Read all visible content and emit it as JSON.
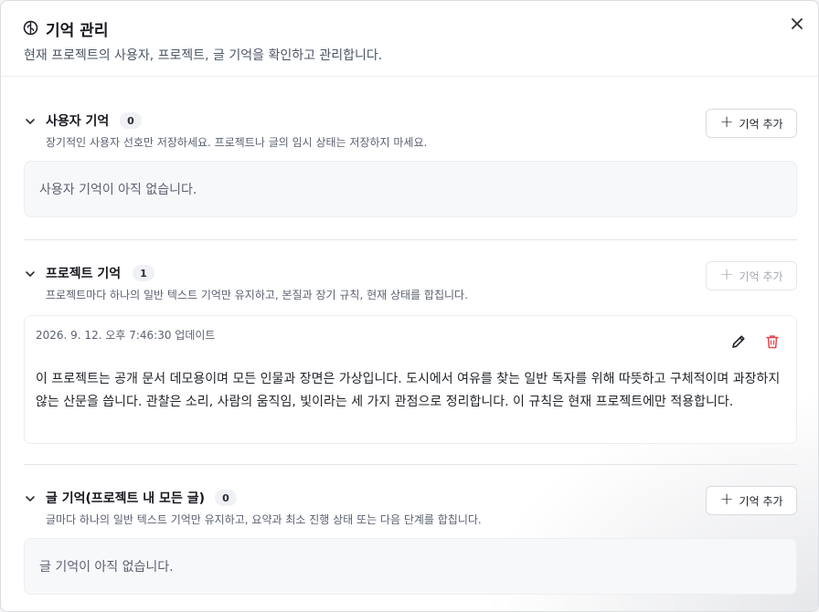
{
  "dialog": {
    "title": "기억 관리",
    "subtitle": "현재 프로젝트의 사용자, 프로젝트, 글 기억을 확인하고 관리합니다.",
    "close_symbol": "×"
  },
  "sections": {
    "user": {
      "title": "사용자 기억",
      "count": "0",
      "description": "장기적인 사용자 선호만 저장하세요. 프로젝트나 글의 임시 상태는 저장하지 마세요.",
      "add_label": "기억 추가",
      "empty_text": "사용자 기억이 아직 없습니다."
    },
    "project": {
      "title": "프로젝트 기억",
      "count": "1",
      "description": "프로젝트마다 하나의 일반 텍스트 기억만 유지하고, 본질과 장기 규칙, 현재 상태를 합칩니다.",
      "add_label": "기억 추가",
      "add_disabled": true,
      "memory": {
        "updated": "2026. 9. 12. 오후 7:46:30 업데이트",
        "text": "이 프로젝트는 공개 문서 데모용이며 모든 인물과 장면은 가상입니다. 도시에서 여유를 찾는 일반 독자를 위해 따뜻하고 구체적이며 과장하지 않는 산문을 씁니다. 관찰은 소리, 사람의 움직임, 빛이라는 세 가지 관점으로 정리합니다. 이 규칙은 현재 프로젝트에만 적용합니다."
      }
    },
    "article": {
      "title": "글 기억(프로젝트 내 모든 글)",
      "count": "0",
      "description": "글마다 하나의 일반 텍스트 기억만 유지하고, 요약과 최소 진행 상태 또는 다음 단계를 합칩니다.",
      "add_label": "기억 추가",
      "empty_text": "글 기억이 아직 없습니다."
    }
  },
  "icons": {
    "title_icon": "brain-icon",
    "close": "close-icon",
    "chevron": "chevron-down-icon",
    "add": "plus-icon",
    "edit": "pencil-icon",
    "delete": "trash-icon"
  },
  "colors": {
    "delete_icon": "#e5484d",
    "disabled_text": "#a3a7af",
    "badge_bg": "#f0f1f4"
  }
}
